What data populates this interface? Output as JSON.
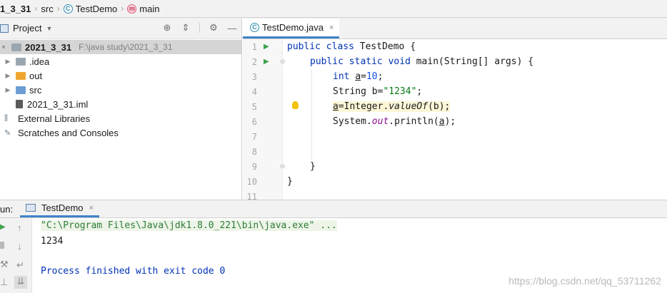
{
  "breadcrumb": {
    "project": "1_3_31",
    "folder": "src",
    "class_name": "TestDemo",
    "class_icon": "C",
    "method_name": "main",
    "method_icon": "m"
  },
  "project_panel": {
    "title": "Project",
    "items": [
      {
        "label": "2021_3_31",
        "hint": "F:\\java study\\2021_3_31"
      },
      {
        "label": ".idea"
      },
      {
        "label": "out"
      },
      {
        "label": "src"
      },
      {
        "label": "2021_3_31.iml"
      },
      {
        "label": "External Libraries"
      },
      {
        "label": "Scratches and Consoles"
      }
    ]
  },
  "editor": {
    "tab_label": "TestDemo.java",
    "tab_close": "×",
    "line_numbers": [
      "1",
      "2",
      "3",
      "4",
      "5",
      "6",
      "7",
      "8",
      "9",
      "10",
      "11"
    ],
    "code": {
      "l1": {
        "kw1": "public",
        "kw2": "class",
        "rest": " TestDemo {"
      },
      "l2": {
        "kw1": "public",
        "kw2": "static",
        "kw3": "void",
        "rest": " main(String[] args) {"
      },
      "l3": {
        "kw": "int",
        "var": "a",
        "eq": "=",
        "num": "10",
        "end": ";"
      },
      "l4": {
        "pre": "String b=",
        "str": "\"1234\"",
        "end": ";"
      },
      "l5": {
        "var": "a",
        "mid": "=Integer.",
        "method": "valueOf",
        "end": "(b);"
      },
      "l6": {
        "pre": "System.",
        "field": "out",
        "mid": ".println(",
        "var": "a",
        "end": ");"
      },
      "l9": "}",
      "l10": "}"
    }
  },
  "run": {
    "label": "un:",
    "tab_label": "TestDemo",
    "tab_close": "×",
    "cmd": "\"C:\\Program Files\\Java\\jdk1.8.0_221\\bin\\java.exe\" ...",
    "output": "1234",
    "finished": "Process finished with exit code 0"
  },
  "watermark": "https://blog.csdn.net/qq_53711262",
  "colors": {
    "accent": "#4083c9",
    "keyword": "#0033b3",
    "number": "#1750eb",
    "string": "#067d17",
    "field": "#871094"
  }
}
